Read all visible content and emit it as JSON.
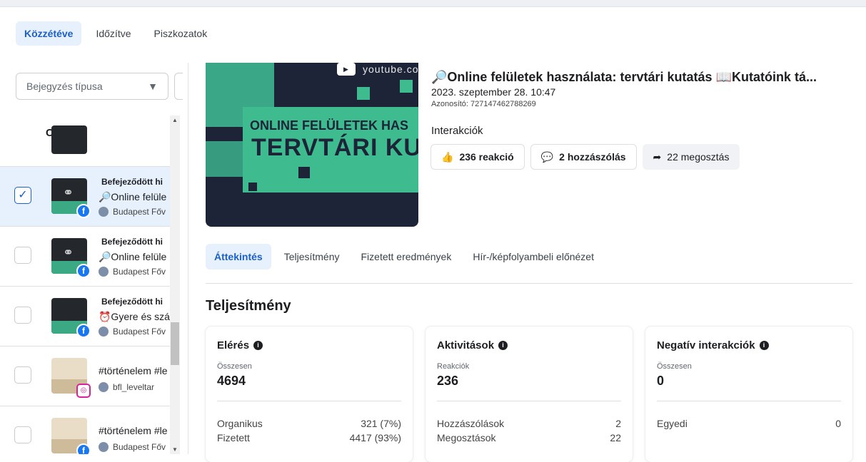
{
  "top_tabs": [
    {
      "label": "Közzétéve",
      "active": true
    },
    {
      "label": "Időzítve",
      "active": false
    },
    {
      "label": "Piszkozatok",
      "active": false
    }
  ],
  "filter": {
    "placeholder": "Bejegyzés típusa"
  },
  "list": {
    "column_title": "Cím",
    "rows": [
      {
        "title": "Befejeződött hi",
        "text": "🔎Online felüle",
        "page": "Budapest Főv",
        "network": "facebook",
        "checked": true
      },
      {
        "title": "Befejeződött hi",
        "text": "🔎Online felüle",
        "page": "Budapest Főv",
        "network": "facebook",
        "checked": false
      },
      {
        "title": "Befejeződött hi",
        "text": "⏰Gyere és szá",
        "page": "Budapest Főv",
        "network": "facebook",
        "checked": false
      },
      {
        "title": "",
        "text": "#történelem #le",
        "page": "bfl_leveltar",
        "network": "instagram",
        "checked": false
      },
      {
        "title": "",
        "text": "#történelem #le",
        "page": "Budapest Főv",
        "network": "facebook",
        "checked": false
      }
    ]
  },
  "preview": {
    "youtube_label": "youtube.co",
    "line1": "ONLINE FELÜLETEK HAS",
    "line2": "TERVTÁRI KUT"
  },
  "post": {
    "title": "🔎Online felületek használata: tervtári kutatás 📖Kutatóink tá...",
    "date": "2023. szeptember 28. 10:47",
    "id": "Azonosító: 727147462788269",
    "interactions_label": "Interakciók",
    "reactions": "236 reakció",
    "comments": "2 hozzászólás",
    "shares": "22 megosztás"
  },
  "detail_tabs": [
    {
      "label": "Áttekintés",
      "active": true
    },
    {
      "label": "Teljesítmény",
      "active": false
    },
    {
      "label": "Fizetett eredmények",
      "active": false
    },
    {
      "label": "Hír-/képfolyambeli előnézet",
      "active": false
    }
  ],
  "section_title": "Teljesítmény",
  "cards": [
    {
      "title": "Elérés",
      "sub": "Összesen",
      "value": "4694",
      "rows": [
        {
          "k": "Organikus",
          "v": "321 (7%)"
        },
        {
          "k": "Fizetett",
          "v": "4417 (93%)"
        }
      ]
    },
    {
      "title": "Aktivitások",
      "sub": "Reakciók",
      "value": "236",
      "rows": [
        {
          "k": "Hozzászólások",
          "v": "2"
        },
        {
          "k": "Megosztások",
          "v": "22"
        }
      ]
    },
    {
      "title": "Negatív interakciók",
      "sub": "Összesen",
      "value": "0",
      "rows": [
        {
          "k": "Egyedi",
          "v": "0"
        }
      ]
    }
  ]
}
